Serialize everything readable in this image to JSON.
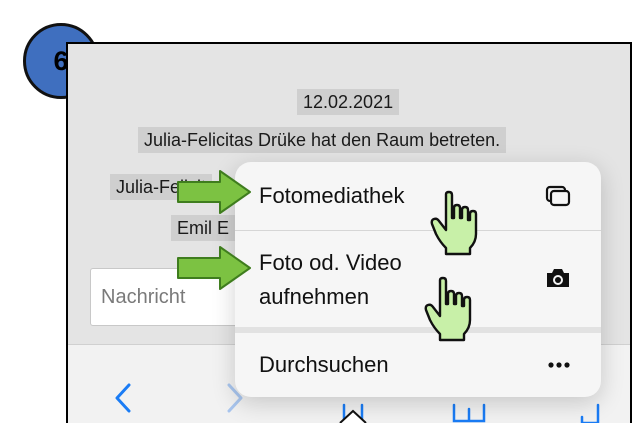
{
  "step": {
    "number": "6"
  },
  "chat": {
    "date": "12.02.2021",
    "event": "Julia-Felicitas Drüke hat den Raum betreten.",
    "partial_name_1": "Julia-Felicit",
    "partial_name_2": "Emil E"
  },
  "input": {
    "placeholder": "Nachricht"
  },
  "menu": {
    "items": [
      {
        "label": "Fotomediathek",
        "icon": "photo-library-icon"
      },
      {
        "label_line1": "Foto od. Video",
        "label_line2": "aufnehmen",
        "icon": "camera-icon"
      },
      {
        "label": "Durchsuchen",
        "icon": "more-icon"
      }
    ]
  },
  "toolbar": {
    "icons": [
      "back-icon",
      "forward-icon",
      "share-icon",
      "bookmarks-icon",
      "tabs-icon"
    ],
    "accent": "#1a7cf5"
  },
  "annotations": {
    "arrow_color": "#7cc242",
    "cursor_color": "#c8f0a8"
  }
}
